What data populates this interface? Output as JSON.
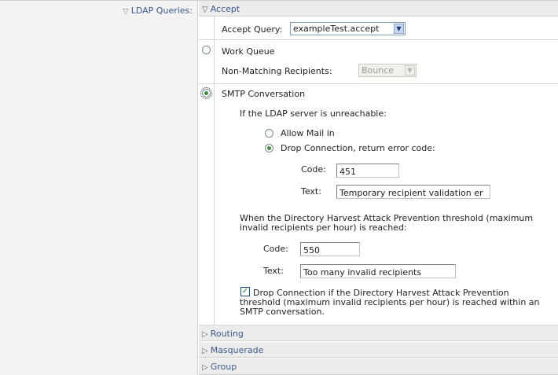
{
  "ldap_queries_label": "LDAP Queries:",
  "accept": {
    "header": "Accept",
    "accept_query_label": "Accept Query:",
    "accept_query_value": "exampleTest.accept"
  },
  "work_queue": {
    "label": "Work Queue",
    "selected": false,
    "non_matching_label": "Non-Matching Recipients:",
    "non_matching_value": "Bounce"
  },
  "smtp_conversation": {
    "label": "SMTP Conversation",
    "selected": true,
    "unreachable_heading": "If the LDAP server is unreachable:",
    "allow_mail_label": "Allow Mail in",
    "drop_connection_label": "Drop Connection, return error code:",
    "drop_connection_selected": true,
    "code_label": "Code:",
    "code_value": "451",
    "text_label": "Text:",
    "text_value": "Temporary recipient validation er",
    "dhap_heading_line1": "When the Directory Harvest Attack Prevention threshold (maximum",
    "dhap_heading_line2": "invalid recipients per hour) is reached:",
    "dhap_code_label": "Code:",
    "dhap_code_value": "550",
    "dhap_text_label": "Text:",
    "dhap_text_value": "Too many invalid recipients",
    "drop_checkbox_checked": true,
    "drop_checkbox_line1": "Drop Connection if the Directory Harvest Attack Prevention",
    "drop_checkbox_line2": "threshold (maximum invalid recipients per hour) is reached within an",
    "drop_checkbox_line3": "SMTP conversation."
  },
  "collapsed_sections": {
    "routing": "Routing",
    "masquerade": "Masquerade",
    "group": "Group"
  },
  "icons": {
    "expanded": "triangle-down-icon",
    "collapsed": "triangle-right-icon"
  },
  "colors": {
    "label_text": "#3a5a8a",
    "section_bg": "#ececec",
    "label_col_bg": "#f3f3f3",
    "check_green": "#2a8a2a"
  }
}
